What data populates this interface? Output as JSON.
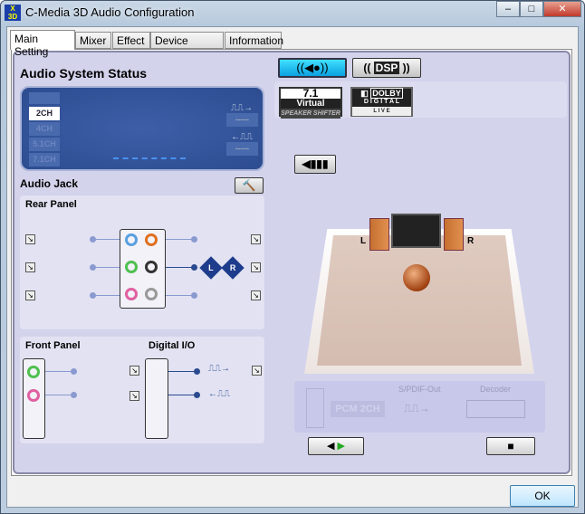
{
  "window": {
    "title": "C-Media 3D Audio Configuration",
    "logo_text": "Xear 3D",
    "min": "–",
    "max": "□",
    "close": "✕"
  },
  "tabs": [
    "Main Setting",
    "Mixer",
    "Effect",
    "Device Setting",
    "Information"
  ],
  "status": {
    "heading": "Audio System Status",
    "channels": [
      "2CH",
      "4CH",
      "5.1CH",
      "7.1CH"
    ],
    "selected": "2CH",
    "out_value": "-----",
    "in_value": "-----"
  },
  "audio_jack": {
    "heading": "Audio Jack",
    "rear_panel": "Rear Panel",
    "front_panel": "Front Panel",
    "digital_io": "Digital I/O",
    "left": "L",
    "right": "R"
  },
  "right": {
    "virtual_top": "7.1",
    "virtual_mid": "Virtual",
    "virtual_bottom": "SPEAKER SHIFTER",
    "dolby": "DOLBY",
    "dolby_digital": "D I G I T A L",
    "dolby_live": "L I V E",
    "dsp": "DSP",
    "speaker_left": "L",
    "speaker_right": "R"
  },
  "spdif": {
    "pcm": "PCM 2CH",
    "label": "S/PDIF-Out",
    "decoder": "Decoder"
  },
  "ok": "OK"
}
